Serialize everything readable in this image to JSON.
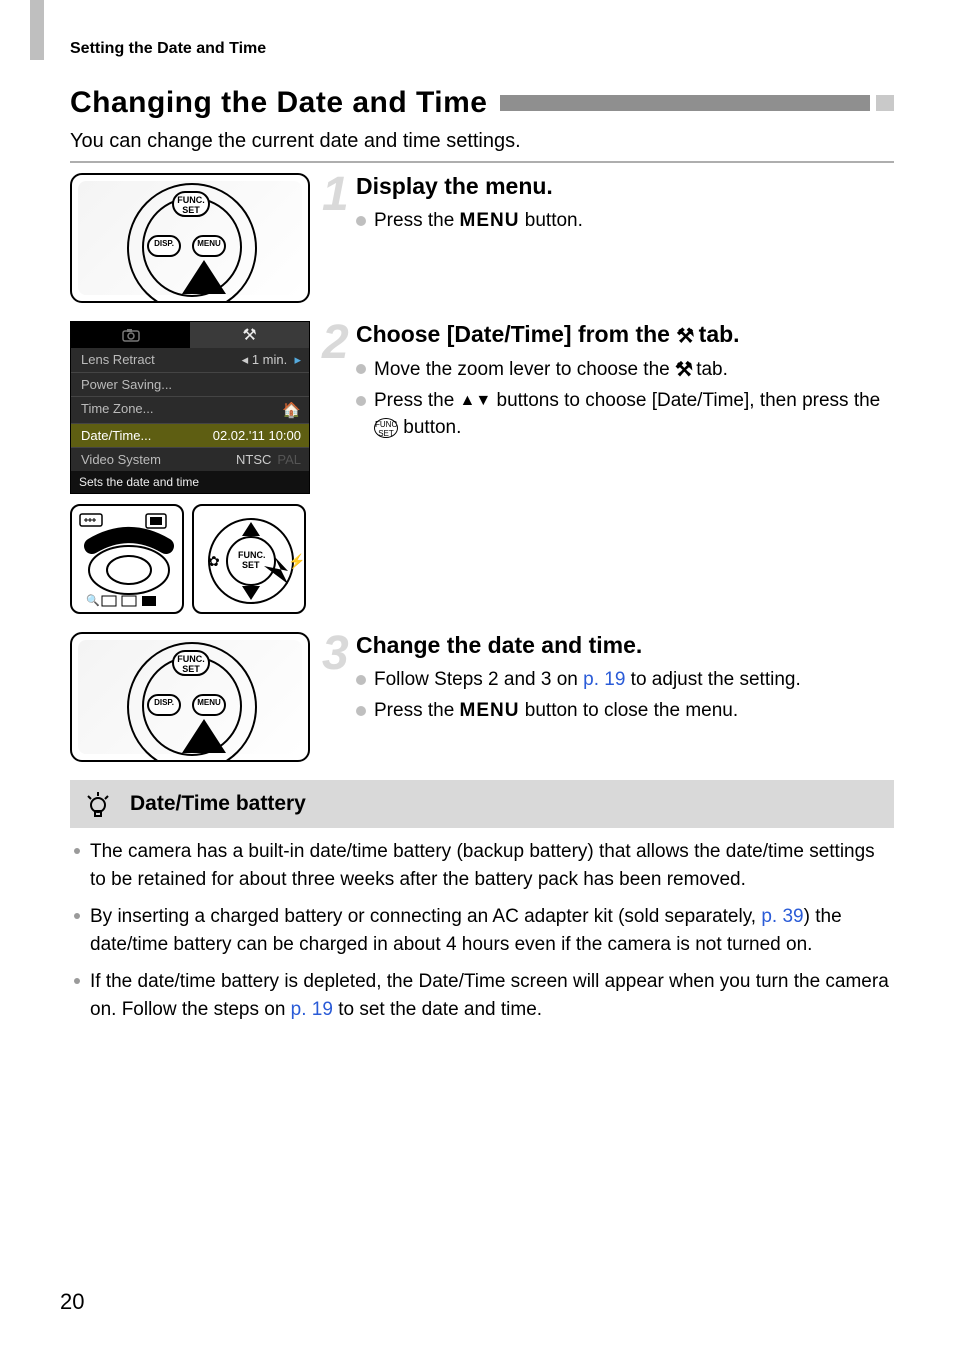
{
  "header": "Setting the Date and Time",
  "title": "Changing the Date and Time",
  "intro": "You can change the current date and time settings.",
  "steps": {
    "s1": {
      "num": "1",
      "heading": "Display the menu.",
      "b1_pre": "Press the ",
      "b1_menu": "MENU",
      "b1_post": " button."
    },
    "s2": {
      "num": "2",
      "heading_pre": "Choose [Date/Time] from the ",
      "heading_post": " tab.",
      "b1_pre": "Move the zoom lever to choose the ",
      "b1_post": " tab.",
      "b2_pre": "Press the ",
      "b2_mid": " buttons to choose [Date/Time], then press the ",
      "b2_post": " button.",
      "func_label": "FUNC.\nSET"
    },
    "s3": {
      "num": "3",
      "heading": "Change the date and time.",
      "b1_pre": "Follow Steps 2 and 3 on ",
      "b1_link": "p. 19",
      "b1_post": " to adjust the setting.",
      "b2_pre": "Press the ",
      "b2_menu": "MENU",
      "b2_post": " button to close the menu."
    }
  },
  "menu": {
    "tab_cam": "camera-icon",
    "tab_tools": "tools-icon",
    "items": [
      {
        "label": "Lens Retract",
        "value": "1 min.",
        "arrows": true
      },
      {
        "label": "Power Saving...",
        "value": ""
      },
      {
        "label": "Time Zone...",
        "value": "⌂"
      },
      {
        "label": "Date/Time...",
        "value": "02.02.'11 10:00",
        "selected": true
      },
      {
        "label": "Video System",
        "value": "NTSC",
        "pal": "PAL"
      }
    ],
    "footer": "Sets the date and time"
  },
  "note": {
    "title": "Date/Time battery",
    "i1": "The camera has a built-in date/time battery (backup battery) that allows the date/time settings to be retained for about three weeks after the battery pack has been removed.",
    "i2_pre": "By inserting a charged battery or connecting an AC adapter kit (sold separately, ",
    "i2_link": "p. 39",
    "i2_post": ") the date/time battery can be charged in about 4 hours even if the camera is not turned on.",
    "i3_pre": "If the date/time battery is depleted, the Date/Time screen will appear when you turn the camera on. Follow the steps on ",
    "i3_link": "p. 19",
    "i3_post": " to set the date and time."
  },
  "page_number": "20",
  "icons": {
    "tools_glyph": "⚒",
    "up_down": "▲▼",
    "func_inline": "FUNC SET",
    "left_tri": "◂",
    "right_tri": "▸"
  }
}
